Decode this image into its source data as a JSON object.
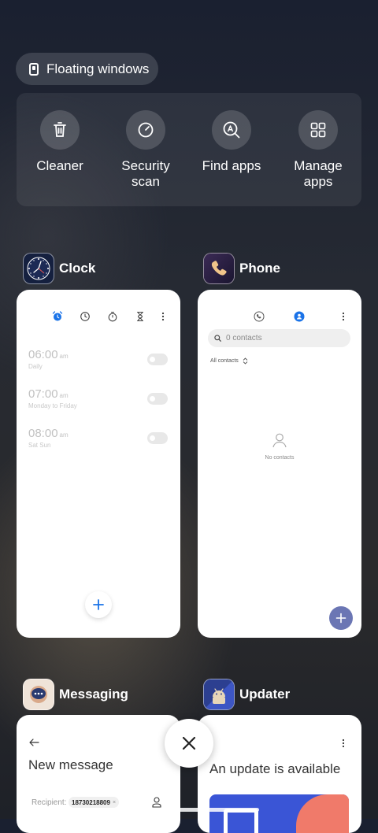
{
  "floating_windows": {
    "label": "Floating windows"
  },
  "quick_actions": [
    {
      "label": "Cleaner",
      "icon": "trash-icon"
    },
    {
      "label": "Security\nscan",
      "icon": "security-scan-icon"
    },
    {
      "label": "Find apps",
      "icon": "find-apps-icon"
    },
    {
      "label": "Manage\napps",
      "icon": "grid-icon"
    }
  ],
  "apps": {
    "clock": {
      "name": "Clock",
      "alarms": [
        {
          "time": "06:00",
          "ampm": "am",
          "repeat": "Daily"
        },
        {
          "time": "07:00",
          "ampm": "am",
          "repeat": "Monday to Friday"
        },
        {
          "time": "08:00",
          "ampm": "am",
          "repeat": "Sat Sun"
        }
      ]
    },
    "phone": {
      "name": "Phone",
      "search_placeholder": "0 contacts",
      "filter": "All contacts",
      "empty": "No contacts"
    },
    "messaging": {
      "name": "Messaging",
      "title": "New message",
      "recipient_label": "Recipient:",
      "recipient_value": "18730218809"
    },
    "updater": {
      "name": "Updater",
      "title": "An update is available"
    }
  },
  "colors": {
    "accent_blue": "#1a73e8",
    "fab_purple": "#6b76b4",
    "banner_blue": "#3a55d6",
    "banner_red": "#f07a6a"
  }
}
